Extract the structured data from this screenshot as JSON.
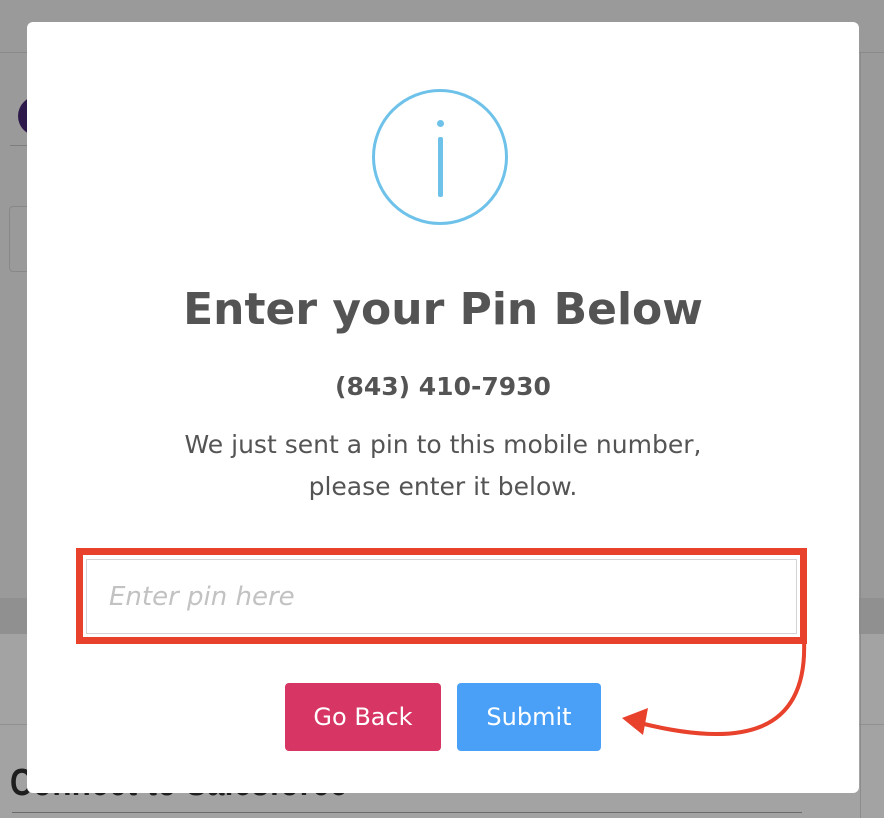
{
  "background": {
    "heading": "Connect to Salesforce"
  },
  "modal": {
    "icon": "info-circle-icon",
    "icon_color": "#6ec2ea",
    "title": "Enter your Pin Below",
    "phone": "(843) 410-7930",
    "message_line1": "We just sent a pin to this mobile number,",
    "message_line2": "please enter it below.",
    "pin_input": {
      "value": "",
      "placeholder": "Enter pin here"
    },
    "go_back_label": "Go Back",
    "submit_label": "Submit"
  },
  "annotation": {
    "highlight_color": "#e8412c",
    "arrow_icon": "curved-arrow-icon"
  },
  "colors": {
    "go_back": "#d73563",
    "submit": "#4aa0f7",
    "text": "#545454"
  }
}
